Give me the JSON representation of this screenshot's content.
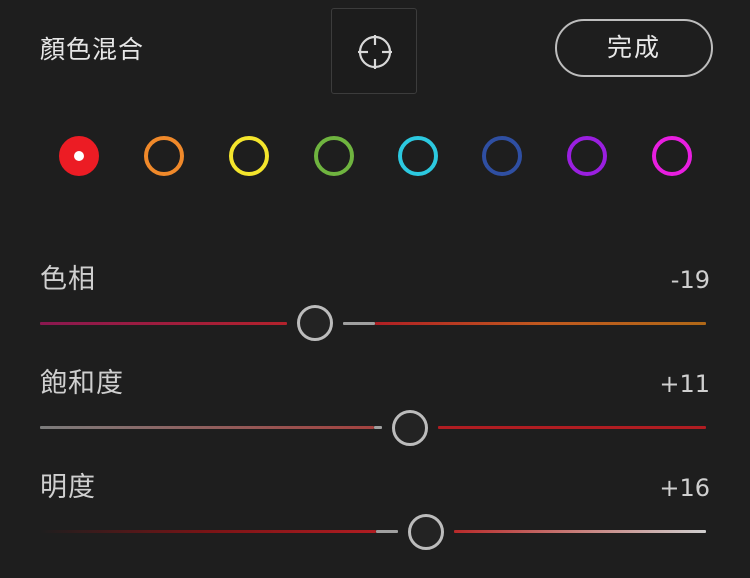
{
  "header": {
    "title": "顏色混合",
    "target_icon": "crosshair-target-icon",
    "done_label": "完成"
  },
  "swatches": [
    {
      "name": "red",
      "color": "#ec1c24",
      "selected": true
    },
    {
      "name": "orange",
      "color": "#f0892a",
      "selected": false
    },
    {
      "name": "yellow",
      "color": "#f4e52c",
      "selected": false
    },
    {
      "name": "green",
      "color": "#6fb43f",
      "selected": false
    },
    {
      "name": "aqua",
      "color": "#2cc9e0",
      "selected": false
    },
    {
      "name": "blue",
      "color": "#2f4fa2",
      "selected": false
    },
    {
      "name": "purple",
      "color": "#9a1fe0",
      "selected": false
    },
    {
      "name": "magenta",
      "color": "#e81ee0",
      "selected": false
    }
  ],
  "sliders": [
    {
      "label": "色相",
      "value": "-19",
      "numeric": -19
    },
    {
      "label": "飽和度",
      "value": "+11",
      "numeric": 11
    },
    {
      "label": "明度",
      "value": "+16",
      "numeric": 16
    }
  ]
}
